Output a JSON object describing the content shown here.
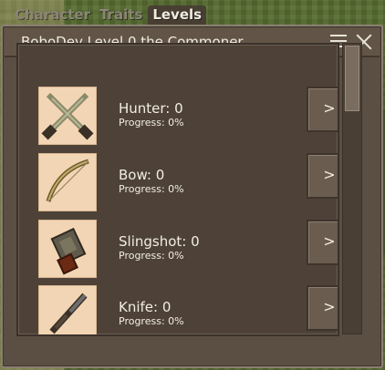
{
  "tabs": [
    {
      "label": "Character"
    },
    {
      "label": "Traits"
    },
    {
      "label": "Levels"
    }
  ],
  "window": {
    "title": "BoboDev Level 0 the Commoner"
  },
  "skills": [
    {
      "name": "Hunter: 0",
      "progress": "Progress: 0%",
      "icon": "crossed-swords-icon",
      "button": ">"
    },
    {
      "name": "Bow: 0",
      "progress": "Progress: 0%",
      "icon": "bow-icon",
      "button": ">"
    },
    {
      "name": "Slingshot: 0",
      "progress": "Progress: 0%",
      "icon": "slingshot-icon",
      "button": ">"
    },
    {
      "name": "Knife: 0",
      "progress": "Progress: 0%",
      "icon": "knife-icon",
      "button": ">"
    }
  ],
  "colors": {
    "window_bg": "#5b4f43",
    "icon_bg": "#f2d5b4",
    "text": "#f2ede3"
  }
}
